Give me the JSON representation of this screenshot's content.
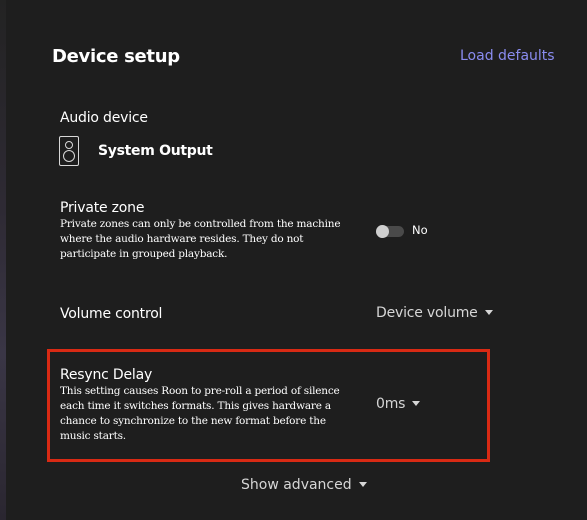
{
  "dialog": {
    "title": "Device setup",
    "load_defaults": "Load defaults"
  },
  "audio_device": {
    "label": "Audio device",
    "name": "System Output",
    "icon": "speaker-icon"
  },
  "private_zone": {
    "label": "Private zone",
    "description": "Private zones can only be controlled from the machine where the audio hardware resides. They do not participate in grouped playback.",
    "toggle_state": "No",
    "enabled": false
  },
  "volume_control": {
    "label": "Volume control",
    "value": "Device volume"
  },
  "resync_delay": {
    "label": "Resync Delay",
    "description": "This setting causes Roon to pre-roll a period of silence each time it switches formats. This gives hardware a chance to synchronize to the new format before the music starts.",
    "value": "0ms",
    "highlight_color": "#d92a14"
  },
  "show_advanced": "Show advanced",
  "colors": {
    "background": "#1e1e1e",
    "link": "#8a8cf0",
    "highlight": "#d92a14"
  }
}
